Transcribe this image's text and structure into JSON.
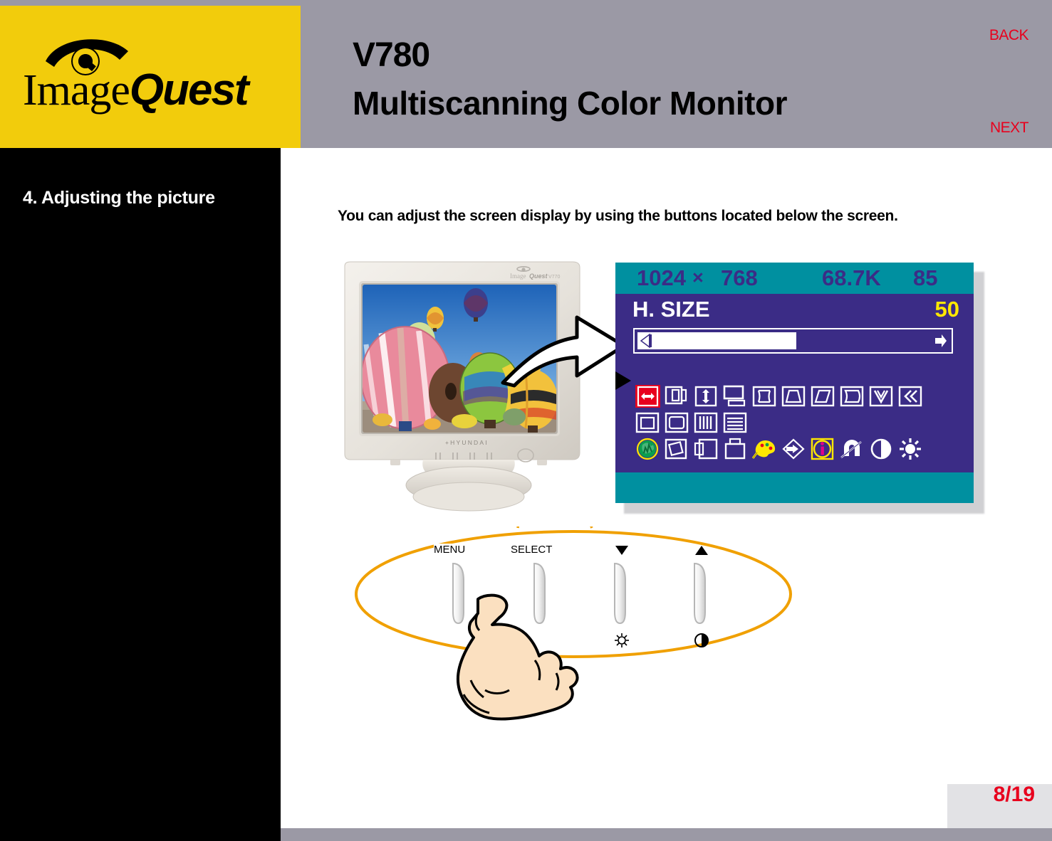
{
  "header": {
    "logo_text_1": "Image",
    "logo_text_2": "Quest",
    "logo_icon": "eye-logo-icon",
    "model": "V780",
    "title": "Multiscanning Color Monitor",
    "nav_back": "BACK",
    "nav_next": "NEXT",
    "band_color": "#9b99a5",
    "logo_bg_color": "#f2cc0c",
    "nav_color": "#e8001d"
  },
  "sidebar": {
    "heading": "4. Adjusting the picture",
    "bg_color": "#000000",
    "text_color": "#ffffff"
  },
  "content": {
    "intro": "You can adjust the screen display by using the buttons located below the screen.",
    "monitor": {
      "brand_label": "HYUNDAI",
      "bezel_logo": "ImageQuest V770",
      "screen_image": "hot-air-balloons-photo"
    },
    "arrow": "curved-flow-arrow"
  },
  "osd": {
    "resolution_width": "1024",
    "resolution_sep": "×",
    "resolution_height": "768",
    "h_frequency": "68.7K",
    "v_frequency": "85",
    "item_label": "H. SIZE",
    "item_value": "50",
    "slider_percent": 50,
    "topbar_color": "#0090a0",
    "body_color": "#3b2c86",
    "value_color": "#ffe800",
    "selected_color": "#e8001d",
    "icon_rows": [
      [
        {
          "name": "h-size-icon",
          "selected": true
        },
        {
          "name": "h-position-icon",
          "selected": false
        },
        {
          "name": "v-size-icon",
          "selected": false
        },
        {
          "name": "v-position-icon",
          "selected": false
        },
        {
          "name": "pincushion-icon",
          "selected": false
        },
        {
          "name": "trapezoid-icon",
          "selected": false
        },
        {
          "name": "parallelogram-icon",
          "selected": false
        },
        {
          "name": "pin-balance-icon",
          "selected": false
        },
        {
          "name": "rotation-icon",
          "selected": false
        },
        {
          "name": "corner-correction-icon",
          "selected": false
        }
      ],
      [
        {
          "name": "top-corner-icon",
          "selected": false
        },
        {
          "name": "bottom-corner-icon",
          "selected": false
        },
        {
          "name": "moire-vertical-icon",
          "selected": false
        },
        {
          "name": "moire-horizontal-icon",
          "selected": false
        }
      ],
      [
        {
          "name": "degauss-icon",
          "selected": false
        },
        {
          "name": "convergence-icon",
          "selected": false
        },
        {
          "name": "osd-position-icon",
          "selected": false
        },
        {
          "name": "osd-size-icon",
          "selected": false
        },
        {
          "name": "color-palette-icon",
          "selected": false
        },
        {
          "name": "language-icon",
          "selected": false
        },
        {
          "name": "information-icon",
          "selected": false
        },
        {
          "name": "recall-icon",
          "selected": false
        },
        {
          "name": "contrast-icon",
          "selected": false
        },
        {
          "name": "brightness-icon",
          "selected": false
        }
      ]
    ]
  },
  "buttons": {
    "menu_label": "MENU",
    "select_label": "SELECT",
    "down_label": "▼",
    "up_label": "▲",
    "brightness_icon": "brightness-sun-icon",
    "contrast_icon": "contrast-half-circle-icon",
    "callout_color": "#f0a000"
  },
  "footer": {
    "page": "8/19",
    "page_color": "#e8001d",
    "band_color": "#9b99a5"
  }
}
